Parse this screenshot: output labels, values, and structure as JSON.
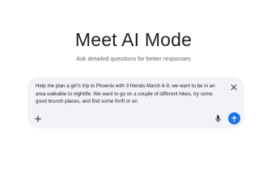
{
  "header": {
    "title": "Meet AI Mode",
    "subtitle": "Ask detailed questions for better responses"
  },
  "prompt_box": {
    "text": "Help me plan a girl's trip to Phoenix with 3 friends March 6-9, we want to be in an area walkable to nightlife. We want to go on a couple of different hikes, try some good brunch places, and find some thrift or an",
    "close_icon": "close-icon",
    "add_icon": "plus-icon",
    "mic_icon": "microphone-icon",
    "send_icon": "arrow-up-icon"
  },
  "colors": {
    "accent": "#1a73e8",
    "card_bg": "#f1f3f8",
    "subtitle": "#5f6368"
  }
}
